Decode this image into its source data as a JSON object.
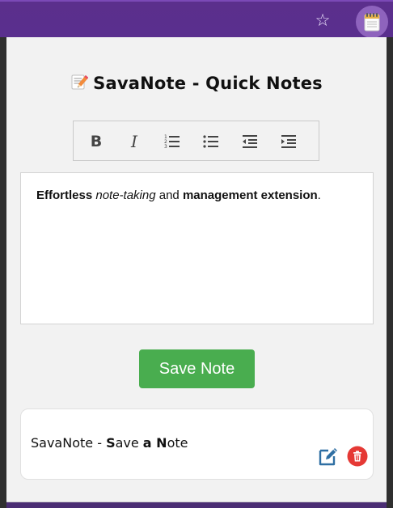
{
  "browser": {
    "bookmark_icon": "star-outline-icon",
    "extension_icon": "notepad-icon"
  },
  "popup": {
    "title_icon": "memo-icon",
    "title": "SavaNote - Quick Notes",
    "toolbar": [
      {
        "name": "bold",
        "icon": "bold-icon",
        "glyph": "B"
      },
      {
        "name": "italic",
        "icon": "italic-icon",
        "glyph": "I"
      },
      {
        "name": "ordered-list",
        "icon": "ordered-list-icon"
      },
      {
        "name": "unordered-list",
        "icon": "unordered-list-icon"
      },
      {
        "name": "outdent",
        "icon": "outdent-icon"
      },
      {
        "name": "indent",
        "icon": "indent-icon"
      }
    ],
    "editor": {
      "segments": [
        {
          "text": "Effortless",
          "style": "bold"
        },
        {
          "text": " ",
          "style": "normal"
        },
        {
          "text": "note-taking",
          "style": "italic"
        },
        {
          "text": " and ",
          "style": "normal"
        },
        {
          "text": "management extension",
          "style": "bold"
        },
        {
          "text": ".",
          "style": "normal"
        }
      ]
    },
    "save_button": "Save Note",
    "notes": [
      {
        "parts": [
          {
            "text": "SavaNote - ",
            "style": "normal"
          },
          {
            "text": "S",
            "style": "bold"
          },
          {
            "text": "ave ",
            "style": "normal"
          },
          {
            "text": "a N",
            "style": "bold"
          },
          {
            "text": "ote",
            "style": "normal"
          }
        ],
        "edit_icon": "edit-icon",
        "delete_icon": "trash-icon"
      }
    ]
  },
  "colors": {
    "browser_bar": "#5a2f8e",
    "save_button": "#49ad4f",
    "delete_button": "#e53935",
    "edit_icon": "#2f6fa3"
  }
}
